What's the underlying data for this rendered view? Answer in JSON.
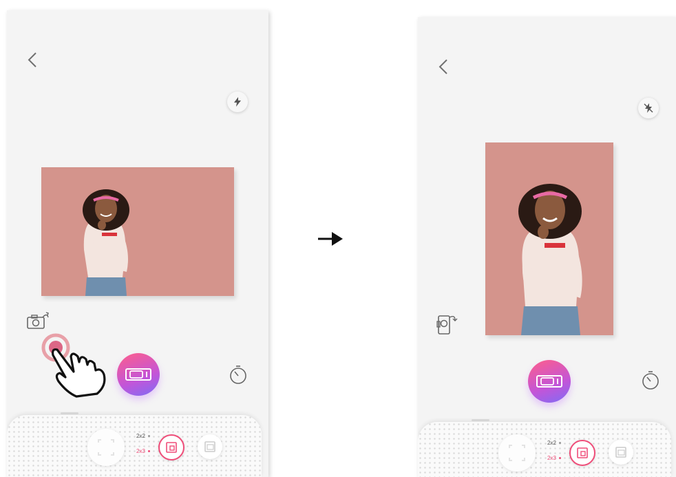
{
  "colors": {
    "background": "#f4f4f4",
    "photo_bg": "#d4948c",
    "accent_pink": "#ef4d79",
    "shutter_gradient": [
      "#ff5e8a",
      "#c255d8",
      "#7f6cf5"
    ]
  },
  "icons": {
    "back": "chevron-left-icon",
    "flash": "flash-icon",
    "flash_off": "flash-off-icon",
    "rotate": "rotate-camera-icon",
    "shutter": "camera-icon",
    "timer": "timer-icon",
    "tap": "hand-pointer-icon",
    "arrow": "arrow-right-icon"
  },
  "left_screen": {
    "orientation": "landscape",
    "size_options": [
      {
        "label": "2x2",
        "selected": false
      },
      {
        "label": "2x3",
        "selected": true
      }
    ]
  },
  "right_screen": {
    "orientation": "portrait",
    "size_options": [
      {
        "label": "2x2",
        "selected": false
      },
      {
        "label": "2x3",
        "selected": true
      }
    ]
  }
}
